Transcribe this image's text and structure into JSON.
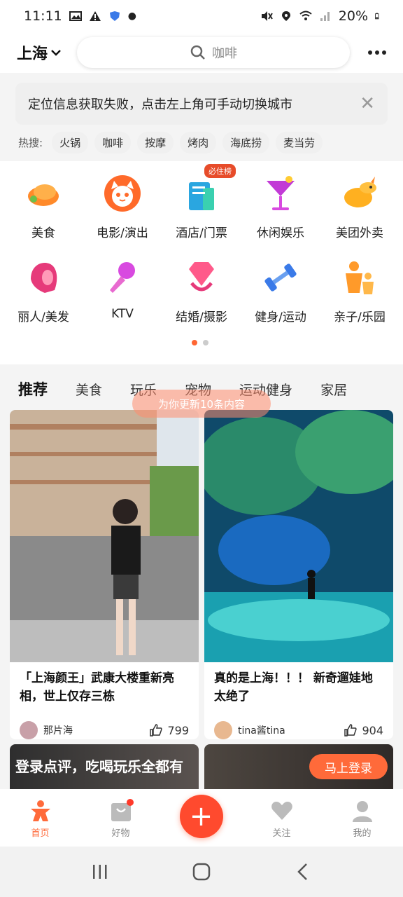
{
  "status": {
    "time": "11:11",
    "battery": "20%"
  },
  "header": {
    "city": "上海",
    "search_placeholder": "咖啡"
  },
  "notice": {
    "text": "定位信息获取失败，点击左上角可手动切换城市"
  },
  "hot": {
    "label": "热搜:",
    "items": [
      "火锅",
      "咖啡",
      "按摩",
      "烤肉",
      "海底捞",
      "麦当劳"
    ]
  },
  "categories": [
    {
      "label": "美食",
      "icon": "roast-chicken-icon",
      "color": "#ff8a2a"
    },
    {
      "label": "电影/演出",
      "icon": "cat-face-icon",
      "color": "#ff6a2a"
    },
    {
      "label": "酒店/门票",
      "icon": "hotel-building-icon",
      "color": "#2aa6e0",
      "badge": "必住榜"
    },
    {
      "label": "休闲娱乐",
      "icon": "cocktail-icon",
      "color": "#c23ad6"
    },
    {
      "label": "美团外卖",
      "icon": "kangaroo-icon",
      "color": "#ffb020"
    },
    {
      "label": "丽人/美发",
      "icon": "hair-icon",
      "color": "#e63a7a"
    },
    {
      "label": "KTV",
      "icon": "microphone-icon",
      "color": "#d84ae0"
    },
    {
      "label": "结婚/摄影",
      "icon": "diamond-icon",
      "color": "#ff5a8a"
    },
    {
      "label": "健身/运动",
      "icon": "dumbbell-icon",
      "color": "#3a7ae8"
    },
    {
      "label": "亲子/乐园",
      "icon": "family-icon",
      "color": "#ff9a2a"
    }
  ],
  "tabs": [
    "推荐",
    "美食",
    "玩乐",
    "宠物",
    "运动健身",
    "家居"
  ],
  "update_pill": "为你更新10条内容",
  "feed": [
    {
      "title": "「上海颜王」武康大楼重新亮相，世上仅存三栋",
      "author": "那片海",
      "likes": "799"
    },
    {
      "title": "真的是上海！！！ 新奇遛娃地太绝了",
      "author": "tina酱tina",
      "likes": "904"
    }
  ],
  "login_banner": {
    "text": "登录点评，吃喝玩乐全都有",
    "button": "马上登录"
  },
  "bottom_nav": [
    {
      "label": "首页",
      "icon": "home-figure-icon"
    },
    {
      "label": "好物",
      "icon": "shopping-bag-icon"
    },
    {
      "label": "",
      "icon": "plus-icon"
    },
    {
      "label": "关注",
      "icon": "heart-icon"
    },
    {
      "label": "我的",
      "icon": "person-icon"
    }
  ]
}
